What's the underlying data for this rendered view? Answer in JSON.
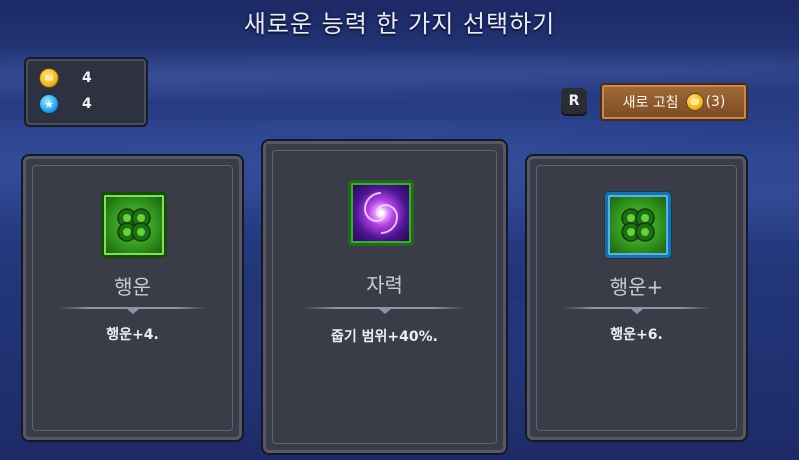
{
  "title": "새로운 능력 한 가지 선택하기",
  "resources": {
    "coins": {
      "icon": "gold-coin-icon",
      "value": "4"
    },
    "gems": {
      "icon": "blue-star-gem-icon",
      "value": "4"
    }
  },
  "reroll": {
    "hotkey": "R",
    "label": "새로 고침",
    "cost_icon": "gold-coin-icon",
    "count": "(3)"
  },
  "cards": [
    {
      "name": "행운",
      "description": "행운+4.",
      "icon": "clover-icon",
      "frame_color": "#174b0b"
    },
    {
      "name": "자력",
      "description": "줍기 범위+40%.",
      "icon": "vortex-icon",
      "frame_color": "#1f6a1c"
    },
    {
      "name": "행운+",
      "description": "행운+6.",
      "icon": "clover-icon",
      "frame_color": "#1d6fa5"
    }
  ],
  "colors": {
    "background": "#26397f",
    "card": "#3a3d48",
    "button": "#7c4a23"
  }
}
